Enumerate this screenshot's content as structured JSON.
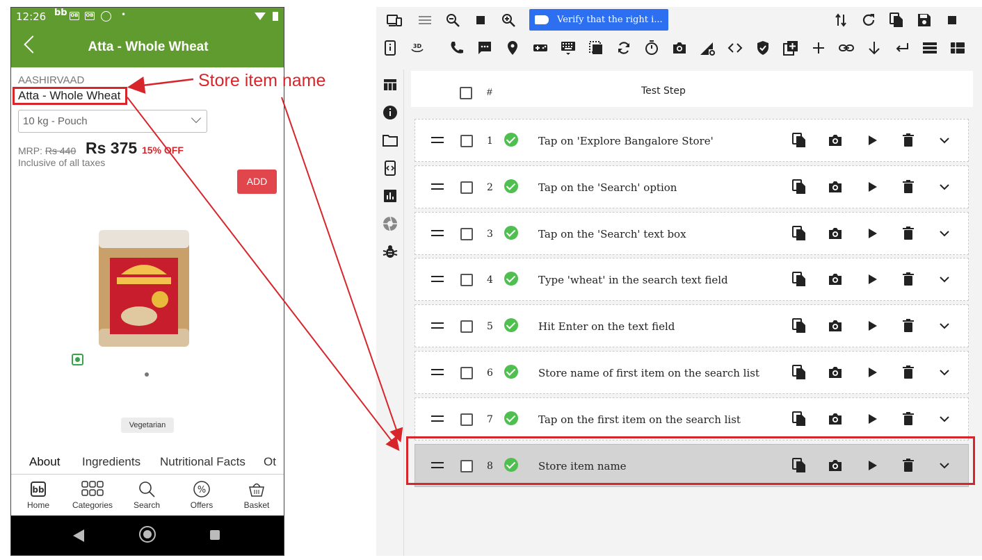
{
  "phone": {
    "status_time": "12:26",
    "status_icons": [
      "bb",
      "OB",
      "OB"
    ],
    "app_title": "Atta - Whole Wheat",
    "brand": "AASHIRVAAD",
    "item_name": "Atta - Whole Wheat",
    "pack_size": "10 kg - Pouch",
    "mrp_label": "MRP:",
    "mrp_value": "Rs 440",
    "price": "Rs 375",
    "discount": "15% OFF",
    "tax_note": "Inclusive of all taxes",
    "add_label": "ADD",
    "veg_chip": "Vegetarian",
    "tabs": [
      "About",
      "Ingredients",
      "Nutritional Facts",
      "Ot"
    ],
    "bottom_nav": [
      {
        "label": "Home",
        "icon": "bb-logo-icon"
      },
      {
        "label": "Categories",
        "icon": "grid-icon"
      },
      {
        "label": "Search",
        "icon": "search-icon"
      },
      {
        "label": "Offers",
        "icon": "percent-icon"
      },
      {
        "label": "Basket",
        "icon": "basket-icon"
      }
    ]
  },
  "annotation": {
    "label": "Store item name",
    "color": "#d7262b"
  },
  "tool": {
    "step_field_text": "Verify that the right i...",
    "header": {
      "hash": "#",
      "test_step": "Test Step"
    },
    "steps": [
      {
        "num": "1",
        "text": "Tap on 'Explore Bangalore Store'",
        "status": "passed"
      },
      {
        "num": "2",
        "text": "Tap on the 'Search' option",
        "status": "passed"
      },
      {
        "num": "3",
        "text": "Tap on the 'Search' text box",
        "status": "passed"
      },
      {
        "num": "4",
        "text": "Type 'wheat' in the search text field",
        "status": "passed"
      },
      {
        "num": "5",
        "text": "Hit Enter on the text field",
        "status": "passed"
      },
      {
        "num": "6",
        "text": "Store name of first item on the search list",
        "status": "passed"
      },
      {
        "num": "7",
        "text": "Tap on the first item on the search list",
        "status": "passed"
      },
      {
        "num": "8",
        "text": "Store item name",
        "status": "passed",
        "selected": true
      }
    ],
    "row_actions": [
      "copy-icon",
      "camera-icon",
      "play-icon",
      "delete-icon",
      "expand-icon"
    ],
    "colors": {
      "accent": "#2c6ff0",
      "pass": "#4fbf4f",
      "brand_green": "#5f9b2f",
      "add_red": "#e0464c"
    }
  }
}
